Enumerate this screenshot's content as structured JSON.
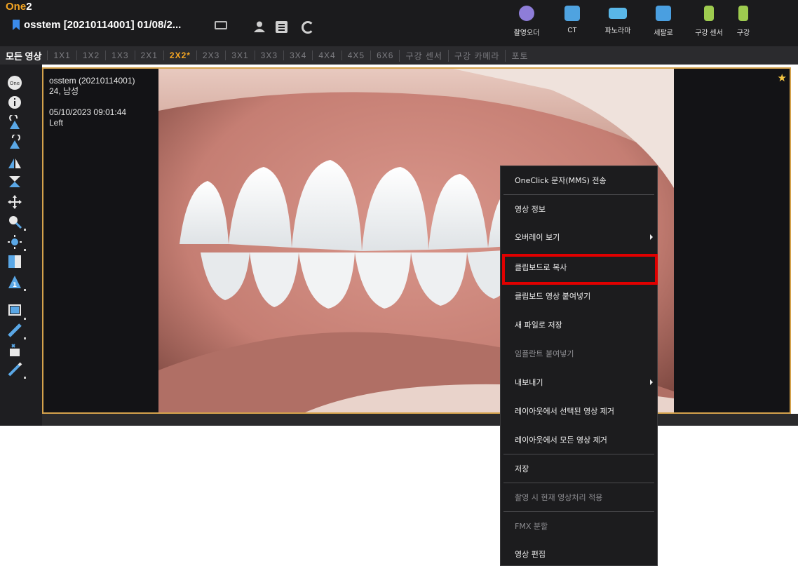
{
  "app": {
    "logo_main": "One",
    "logo_accent": "2"
  },
  "patient": {
    "title": "osstem  [20210114001] 01/08/2..."
  },
  "modes": [
    {
      "label": "촬영오더",
      "icon": "capture-order-icon",
      "color": "#8e7dd8"
    },
    {
      "label": "CT",
      "icon": "ct-icon",
      "color": "#4fa3e0"
    },
    {
      "label": "파노라마",
      "icon": "panorama-icon",
      "color": "#59b7e8"
    },
    {
      "label": "세팔로",
      "icon": "cephalo-icon",
      "color": "#4a9fe0"
    },
    {
      "label": "구강 센서",
      "icon": "intraoral-sensor-icon",
      "color": "#9ecb4f"
    },
    {
      "label": "구강",
      "icon": "intraoral-camera-icon",
      "color": "#9ecb4f"
    }
  ],
  "layoutbar": {
    "all_images": "모든 영상",
    "options": [
      "1X1",
      "1X2",
      "1X3",
      "2X1",
      "2X2*",
      "2X3",
      "3X1",
      "3X3",
      "3X4",
      "4X4",
      "4X5",
      "6X6",
      "구강 센서",
      "구강 카메라",
      "포토"
    ],
    "active": "2X2*"
  },
  "image_info": {
    "name": "osstem (20210114001)",
    "age_sex": "24, 남성",
    "datetime": "05/10/2023 09:01:44",
    "side": "Left"
  },
  "context_menu": {
    "items": [
      {
        "label": "OneClick 문자(MMS) 전송",
        "enabled": true
      },
      {
        "label": "영상 정보",
        "enabled": true
      },
      {
        "label": "오버레이 보기",
        "enabled": true,
        "submenu": true
      },
      {
        "label": "클립보드로 복사",
        "enabled": true,
        "highlighted": true
      },
      {
        "label": "클립보드 영상 붙여넣기",
        "enabled": true
      },
      {
        "label": "새 파일로 저장",
        "enabled": true
      },
      {
        "label": "임플란트 붙여넣기",
        "enabled": false
      },
      {
        "label": "내보내기",
        "enabled": true,
        "submenu": true
      },
      {
        "label": "레이아웃에서 선택된 영상 제거",
        "enabled": true
      },
      {
        "label": "레이아웃에서 모든 영상 제거",
        "enabled": true
      },
      {
        "label": "저장",
        "enabled": true
      },
      {
        "label": "촬영 시 현재 영상처리 적용",
        "enabled": false
      },
      {
        "label": "FMX 분할",
        "enabled": false
      },
      {
        "label": "영상 편집",
        "enabled": true
      }
    ]
  }
}
